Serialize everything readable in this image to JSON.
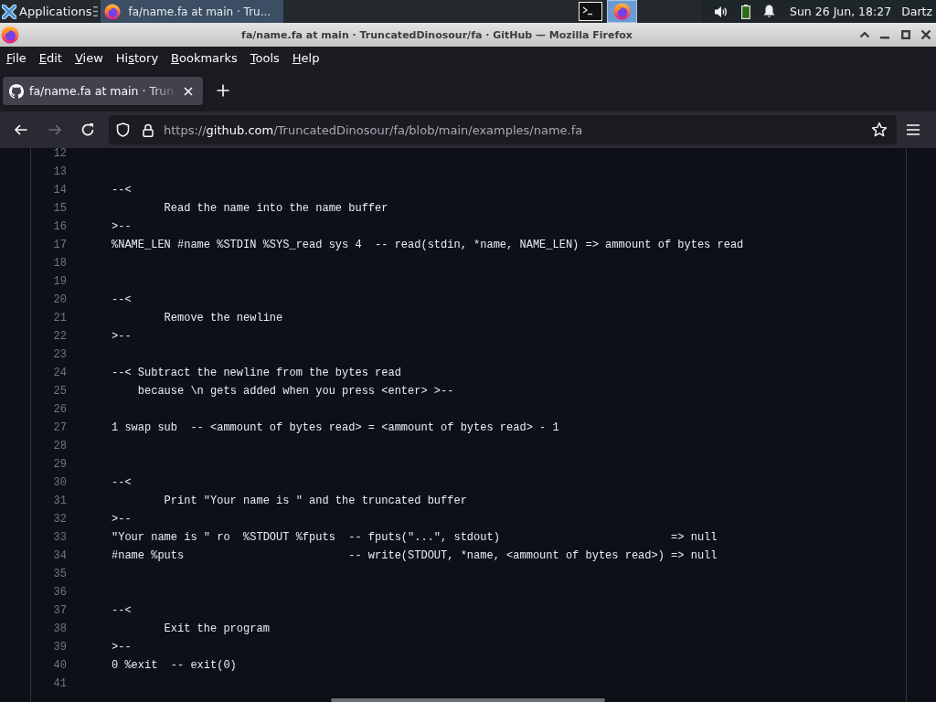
{
  "taskbar": {
    "app_menu": "Applications",
    "tasks": [
      {
        "title": "fa/name.fa at main · Tru...",
        "selected": true
      }
    ],
    "launchers": [
      {
        "kind": "terminal",
        "selected": false
      },
      {
        "kind": "browser",
        "selected": true
      }
    ],
    "clock": "Sun 26 Jun, 18:27",
    "user": "Dartz"
  },
  "window": {
    "title": "fa/name.fa at main · TruncatedDinosour/fa · GitHub — Mozilla Firefox"
  },
  "menu": [
    {
      "underlined": "F",
      "after": "ile"
    },
    {
      "underlined": "E",
      "after": "dit"
    },
    {
      "underlined": "V",
      "after": "iew"
    },
    {
      "before": "Hi",
      "underlined": "s",
      "after": "tory"
    },
    {
      "underlined": "B",
      "after": "ookmarks"
    },
    {
      "underlined": "T",
      "after": "ools"
    },
    {
      "underlined": "H",
      "after": "elp"
    }
  ],
  "tabs": [
    {
      "title": "fa/name.fa at main · Trun",
      "selected": true
    }
  ],
  "navigation": {
    "back": {
      "disabled": false
    },
    "forward": {
      "disabled": true
    },
    "address": {
      "scheme": "https://",
      "host": "github.com",
      "path": "/TruncatedDinosour/fa/blob/main/examples/name.fa"
    }
  },
  "code": {
    "lines": [
      {
        "number": "12"
      },
      {
        "number": "13"
      },
      {
        "number": "14",
        "text": "--<"
      },
      {
        "number": "15",
        "text": "        Read the name into the name buffer"
      },
      {
        "number": "16",
        "text": ">--"
      },
      {
        "number": "17",
        "text": "%NAME_LEN #name %STDIN %SYS_read sys 4  -- read(stdin, *name, NAME_LEN) => ammount of bytes read"
      },
      {
        "number": "18"
      },
      {
        "number": "19"
      },
      {
        "number": "20",
        "text": "--<"
      },
      {
        "number": "21",
        "text": "        Remove the newline"
      },
      {
        "number": "22",
        "text": ">--"
      },
      {
        "number": "23"
      },
      {
        "number": "24",
        "text": "--< Subtract the newline from the bytes read"
      },
      {
        "number": "25",
        "text": "    because \\n gets added when you press <enter> >--"
      },
      {
        "number": "26"
      },
      {
        "number": "27",
        "text": "1 swap sub  -- <ammount of bytes read> = <ammount of bytes read> - 1"
      },
      {
        "number": "28"
      },
      {
        "number": "29"
      },
      {
        "number": "30",
        "text": "--<"
      },
      {
        "number": "31",
        "text": "        Print \"Your name is \" and the truncated buffer"
      },
      {
        "number": "32",
        "text": ">--"
      },
      {
        "number": "33",
        "text": "\"Your name is \" ro  %STDOUT %fputs  -- fputs(\"...\", stdout)                          => null"
      },
      {
        "number": "34",
        "text": "#name %puts                         -- write(STDOUT, *name, <ammount of bytes read>) => null"
      },
      {
        "number": "35"
      },
      {
        "number": "36"
      },
      {
        "number": "37",
        "text": "--<"
      },
      {
        "number": "38",
        "text": "        Exit the program"
      },
      {
        "number": "39",
        "text": ">--"
      },
      {
        "number": "40",
        "text": "0 %exit  -- exit(0)"
      },
      {
        "number": "41"
      }
    ]
  }
}
